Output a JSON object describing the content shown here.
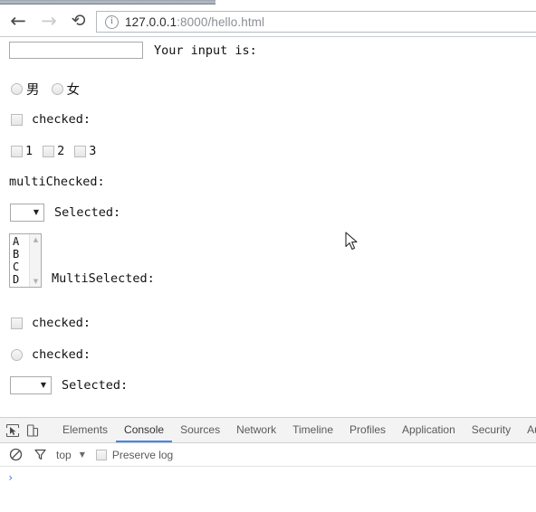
{
  "browser": {
    "back_glyph": "←",
    "forward_glyph": "→",
    "reload_glyph": "⟳",
    "info_glyph": "i",
    "url_host": "127.0.0.1",
    "url_rest": ":8000/hello.html",
    "url_full": "127.0.0.1:8000/hello.html"
  },
  "page": {
    "text_input_value": "",
    "text_input_label": "Your input is:",
    "radio_gender": [
      {
        "label": "男",
        "checked": false
      },
      {
        "label": "女",
        "checked": false
      }
    ],
    "checkbox_single_label": "checked:",
    "checkbox_group": [
      {
        "label": "1",
        "checked": false
      },
      {
        "label": "2",
        "checked": false
      },
      {
        "label": "3",
        "checked": false
      }
    ],
    "multi_checked_label": "multiChecked:",
    "select_single_value": "",
    "select_single_label": "Selected:",
    "select_arrow": "▼",
    "listbox_options": [
      "A",
      "B",
      "C",
      "D"
    ],
    "listbox_scroll_up": "▲",
    "listbox_scroll_down": "▼",
    "multi_selected_label": "MultiSelected:",
    "checkbox_bottom_label": "checked:",
    "radio_bottom_label": "checked:",
    "select_bottom_value": "",
    "select_bottom_label": "Selected:"
  },
  "devtools": {
    "inspect_icon": "inspect-element-icon",
    "device_icon": "device-toolbar-icon",
    "tabs": [
      {
        "label": "Elements",
        "active": false
      },
      {
        "label": "Console",
        "active": true
      },
      {
        "label": "Sources",
        "active": false
      },
      {
        "label": "Network",
        "active": false
      },
      {
        "label": "Timeline",
        "active": false
      },
      {
        "label": "Profiles",
        "active": false
      },
      {
        "label": "Application",
        "active": false
      },
      {
        "label": "Security",
        "active": false
      },
      {
        "label": "Aud",
        "active": false
      }
    ],
    "clear_icon": "clear-console-icon",
    "filter_icon": "filter-funnel-icon",
    "context_value": "top",
    "context_caret": "▼",
    "preserve_log_label": "Preserve log",
    "preserve_log_checked": false,
    "console_prompt": "›",
    "active_tab_underline_color": "#4285f4"
  }
}
